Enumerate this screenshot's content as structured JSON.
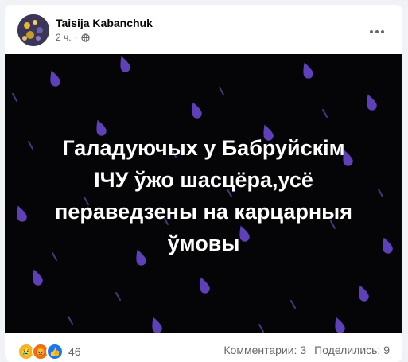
{
  "post": {
    "author": "Taisija Kabanchuk",
    "time": "2 ч.",
    "separator": "·",
    "privacy_icon": "globe-icon",
    "more_icon": "more-icon",
    "text_lines": [
      "Галадуючых у Бабруйскім",
      "ІЧУ ўжо шасцёра,усё",
      "пераведзены на карцарныя",
      "ўмовы"
    ],
    "background_color": "#050507",
    "drop_color": "#6f4bd8",
    "drop_stroke_color": "#3a3f7a"
  },
  "footer": {
    "reactions": [
      "sad-reaction-icon",
      "angry-reaction-icon",
      "like-reaction-icon"
    ],
    "reaction_count": "46",
    "comments": "Комментарии: 3",
    "shares": "Поделились: 9"
  }
}
